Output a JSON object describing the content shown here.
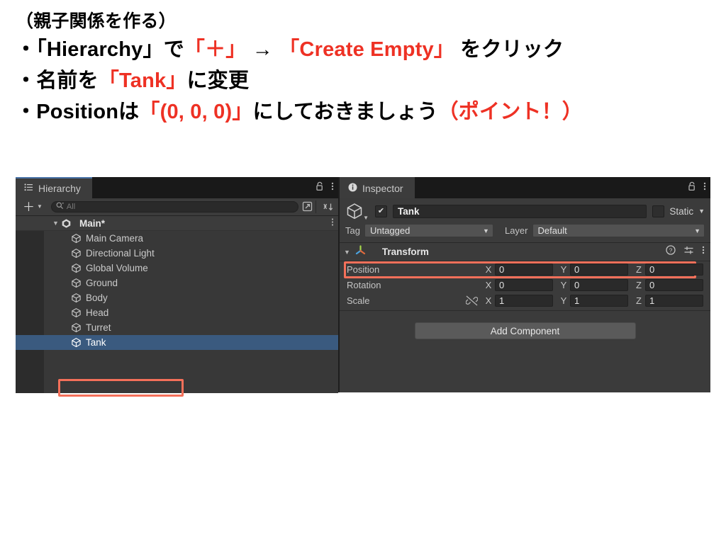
{
  "slide": {
    "line1": "（親子関係を作る）",
    "line2": {
      "a": "・「Hierarchy」で",
      "b": "「＋」",
      "c": " → ",
      "d": "「Create Empty」",
      "e": " をクリック"
    },
    "line3": {
      "a": "・名前を",
      "b": "「Tank」",
      "c": "に変更"
    },
    "line4": {
      "a": "・Positionは",
      "b": "「(0, 0, 0)」",
      "c": "にしておきましょう",
      "d": "（ポイント！）"
    },
    "accent_color": "#ee3124"
  },
  "hierarchy": {
    "tab_label": "Hierarchy",
    "tab_icon": "list-icon",
    "lock_icon": "lock-icon",
    "menu_icon": "kebab-menu-icon",
    "toolbar": {
      "add_label": "＋",
      "add_caret": "▼",
      "search_placeholder": "All",
      "search_value": "",
      "search_icon": "search-icon",
      "open_window_icon": "open-in-window-icon",
      "sort_icon": "sort-alphabetical-icon"
    },
    "scene": {
      "label": "Main*",
      "disclosure": "▼",
      "icon": "unity-logo-icon",
      "menu": "kebab-menu-icon"
    },
    "objects": [
      {
        "label": "Main Camera",
        "selected": false
      },
      {
        "label": "Directional Light",
        "selected": false
      },
      {
        "label": "Global Volume",
        "selected": false
      },
      {
        "label": "Ground",
        "selected": false
      },
      {
        "label": "Body",
        "selected": false
      },
      {
        "label": "Head",
        "selected": false
      },
      {
        "label": "Turret",
        "selected": false
      },
      {
        "label": "Tank",
        "selected": true
      }
    ],
    "selection_color": "#3a5a7f",
    "highlight_color": "#f4705a"
  },
  "inspector": {
    "tab_label": "Inspector",
    "tab_icon": "info-icon",
    "lock_icon": "lock-icon",
    "menu_icon": "kebab-menu-icon",
    "object": {
      "icon": "gameobject-cube-icon",
      "enabled_checkbox": "✔",
      "name_value": "Tank",
      "static_label": "Static",
      "static_checked": false,
      "static_caret": "▼"
    },
    "tag_label": "Tag",
    "tag_value": "Untagged",
    "layer_label": "Layer",
    "layer_value": "Default",
    "transform": {
      "disclosure": "▼",
      "icon": "transform-axis-icon",
      "title": "Transform",
      "help_icon": "help-circle-icon",
      "preset_icon": "preset-sliders-icon",
      "menu_icon": "kebab-menu-icon",
      "rows": [
        {
          "label": "Position",
          "x": "0",
          "y": "0",
          "z": "0",
          "link": false,
          "highlighted": true
        },
        {
          "label": "Rotation",
          "x": "0",
          "y": "0",
          "z": "0",
          "link": false,
          "highlighted": false
        },
        {
          "label": "Scale",
          "x": "1",
          "y": "1",
          "z": "1",
          "link": true,
          "highlighted": false
        }
      ],
      "axis_labels": {
        "x": "X",
        "y": "Y",
        "z": "Z"
      },
      "link_icon": "broken-link-icon"
    },
    "add_component_label": "Add Component"
  }
}
